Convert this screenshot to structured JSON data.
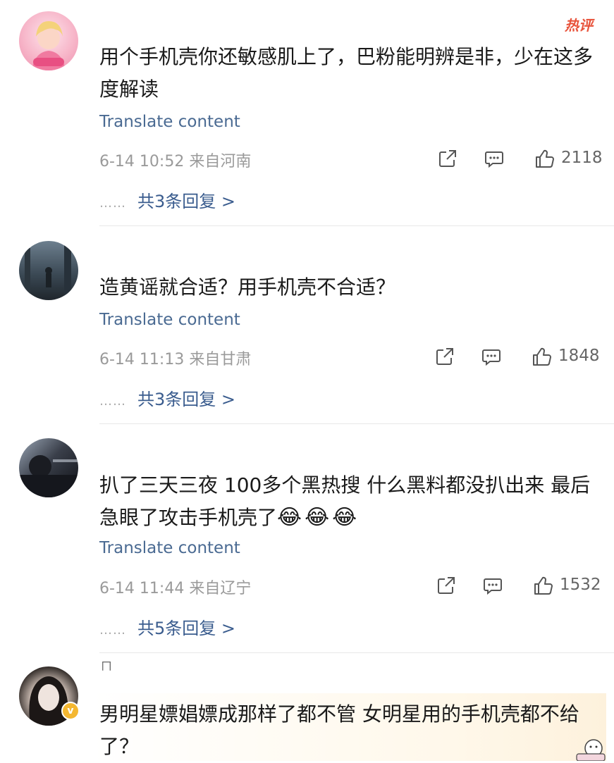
{
  "hot_label": "热评",
  "translate_label": "Translate content",
  "comments": [
    {
      "text": "用个手机壳你还敏感肌上了，巴粉能明辨是非，少在这多度解读",
      "time": "6-14 10:52",
      "location": "来自河南",
      "likes": "2118",
      "replies": "共3条回复 >"
    },
    {
      "text": "造黄谣就合适？用手机壳不合适？",
      "time": "6-14 11:13",
      "location": "来自甘肃",
      "likes": "1848",
      "replies": "共3条回复 >"
    },
    {
      "text": "扒了三天三夜 100多个黑热搜 什么黑料都没扒出来 最后急眼了攻击手机壳了",
      "emoji": "😂😂😂",
      "time": "6-14 11:44",
      "location": "来自辽宁",
      "likes": "1532",
      "replies": "共5条回复 >"
    },
    {
      "fragment": "ㄇ",
      "text": "男明星嫖娼嫖成那样了都不管 女明星用的手机壳都不给了？"
    }
  ],
  "reply_dots": "……",
  "badge": "v"
}
